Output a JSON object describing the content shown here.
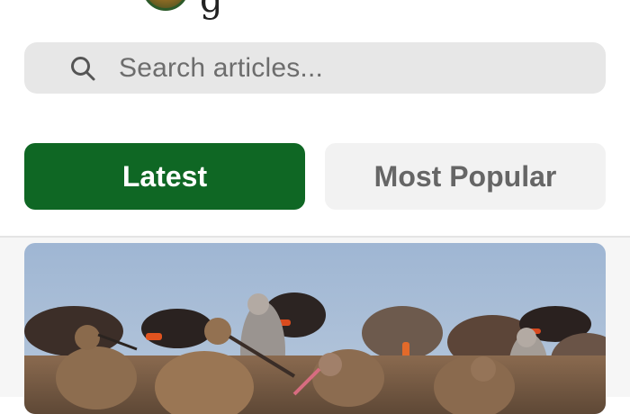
{
  "header": {
    "brand_fragment": "g"
  },
  "search": {
    "placeholder": "Search articles...",
    "icon": "search-icon"
  },
  "tabs": [
    {
      "label": "Latest",
      "active": true
    },
    {
      "label": "Most Popular",
      "active": false
    }
  ],
  "colors": {
    "accent": "#0f6724",
    "tab_inactive_bg": "#f2f2f2",
    "search_bg": "#e7e7e7",
    "sky": "#a9bfd9"
  },
  "feed": {
    "first_article": {
      "image": "shorebirds-photo"
    }
  }
}
